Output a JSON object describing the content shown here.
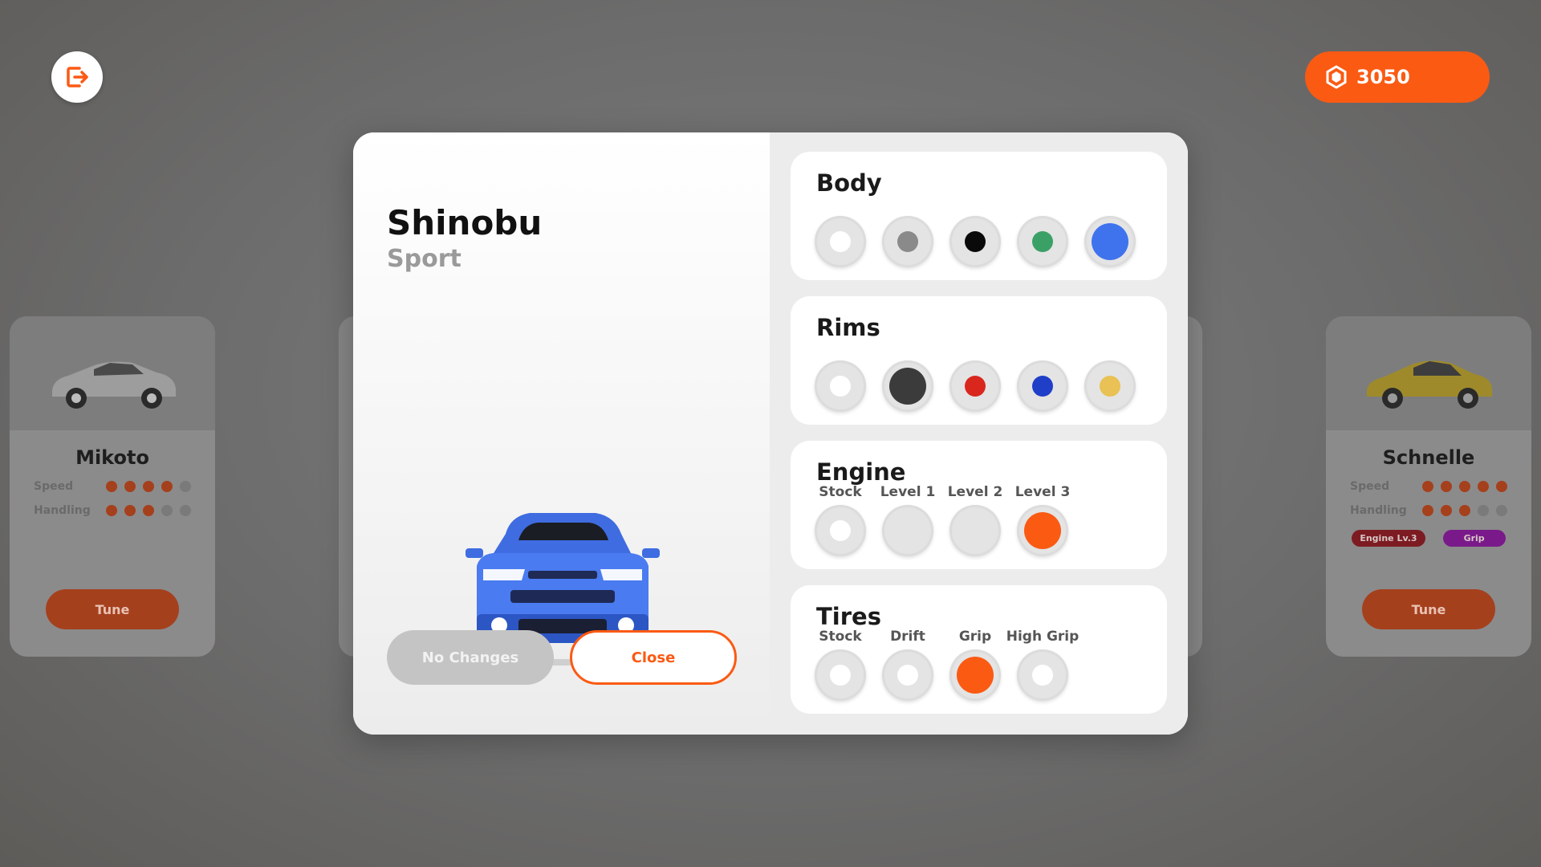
{
  "hud": {
    "exit_icon": "exit-icon",
    "coin_icon": "hexagon-coin-icon",
    "coins": "3050"
  },
  "left_card": {
    "name": "Mikoto",
    "stats": [
      {
        "label": "Speed",
        "value": 4,
        "max": 5
      },
      {
        "label": "Handling",
        "value": 3,
        "max": 5
      }
    ],
    "tune_label": "Tune"
  },
  "right_card": {
    "name": "Schnelle",
    "stats": [
      {
        "label": "Speed",
        "value": 5,
        "max": 5
      },
      {
        "label": "Handling",
        "value": 3,
        "max": 5
      }
    ],
    "tags": [
      "Engine Lv.3",
      "Grip"
    ],
    "tune_label": "Tune"
  },
  "modal": {
    "car_name": "Shinobu",
    "car_class": "Sport",
    "no_changes_label": "No Changes",
    "close_label": "Close",
    "sections": [
      {
        "title": "Body",
        "options": [
          {
            "label": "",
            "color": "#ffffff",
            "selected": false
          },
          {
            "label": "",
            "color": "#8a8a8a",
            "selected": false
          },
          {
            "label": "",
            "color": "#0a0a0a",
            "selected": false
          },
          {
            "label": "",
            "color": "#3aa066",
            "selected": false
          },
          {
            "label": "",
            "color": "#3f73ee",
            "selected": true
          }
        ]
      },
      {
        "title": "Rims",
        "options": [
          {
            "label": "",
            "color": "#ffffff",
            "selected": false
          },
          {
            "label": "",
            "color": "#3b3b3b",
            "selected": true
          },
          {
            "label": "",
            "color": "#d9271e",
            "selected": false
          },
          {
            "label": "",
            "color": "#1f3fc8",
            "selected": false
          },
          {
            "label": "",
            "color": "#e9c154",
            "selected": false
          }
        ]
      },
      {
        "title": "Engine",
        "options": [
          {
            "label": "Stock",
            "color": "#ffffff",
            "selected": false
          },
          {
            "label": "Level 1",
            "color": "#e4e4e4",
            "selected": false
          },
          {
            "label": "Level 2",
            "color": "#e4e4e4",
            "selected": false
          },
          {
            "label": "Level 3",
            "color": "#fb5a13",
            "selected": true
          }
        ]
      },
      {
        "title": "Tires",
        "options": [
          {
            "label": "Stock",
            "color": "#ffffff",
            "selected": false
          },
          {
            "label": "Drift",
            "color": "#ffffff",
            "selected": false
          },
          {
            "label": "Grip",
            "color": "#fb5a13",
            "selected": true
          },
          {
            "label": "High Grip",
            "color": "#ffffff",
            "selected": false
          }
        ]
      }
    ]
  },
  "colors": {
    "accent": "#fb5a13",
    "muted_accent": "#a5401d"
  }
}
